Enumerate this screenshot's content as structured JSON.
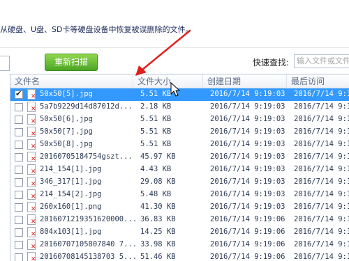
{
  "description": "从硬盘、U盘、SD卡等硬盘设备中恢复被误删除的文件。",
  "toolbar": {
    "scan_label": "重新扫描",
    "quick_find_label": "快速查找:",
    "quick_find_placeholder": "输入文件或文件"
  },
  "table": {
    "columns": [
      "文件名",
      "文件大小",
      "创建日期",
      "最后访问"
    ],
    "rows": [
      {
        "name": "50x50[5].jpg",
        "size": "5.51 KB",
        "created": "2016/7/14 9:19:03",
        "accessed": "2016/7/14 9:19",
        "checked": true,
        "selected": true
      },
      {
        "name": "5a7b9229d14d87012d...",
        "size": "2.18 KB",
        "created": "2016/7/14 9:19:03",
        "accessed": "2016/7/14 9:19",
        "checked": false,
        "selected": false
      },
      {
        "name": "50x50[6].jpg",
        "size": "5.51 KB",
        "created": "2016/7/14 9:19:03",
        "accessed": "2016/7/14 9:19",
        "checked": false,
        "selected": false
      },
      {
        "name": "50x50[7].jpg",
        "size": "5.51 KB",
        "created": "2016/7/14 9:19:03",
        "accessed": "2016/7/14 9:19",
        "checked": false,
        "selected": false
      },
      {
        "name": "50x50[8].jpg",
        "size": "5.51 KB",
        "created": "2016/7/14 9:19:03",
        "accessed": "2016/7/14 9:19",
        "checked": false,
        "selected": false
      },
      {
        "name": "20160705184754gszt...",
        "size": "45.97 KB",
        "created": "2016/7/14 9:19:03",
        "accessed": "2016/7/14 9:19",
        "checked": false,
        "selected": false
      },
      {
        "name": "214_154[1].jpg",
        "size": "4.43 KB",
        "created": "2016/7/14 9:19:03",
        "accessed": "2016/7/14 9:19",
        "checked": false,
        "selected": false
      },
      {
        "name": "346_317[1].jpg",
        "size": "29.08 KB",
        "created": "2016/7/14 9:19:03",
        "accessed": "2016/7/14 9:19",
        "checked": false,
        "selected": false
      },
      {
        "name": "214_154[2].jpg",
        "size": "5.48 KB",
        "created": "2016/7/14 9:19:03",
        "accessed": "2016/7/14 9:19",
        "checked": false,
        "selected": false
      },
      {
        "name": "260x160[1].png",
        "size": "41.30 KB",
        "created": "2016/7/14 9:19:03",
        "accessed": "2016/7/14 9:19",
        "checked": false,
        "selected": false
      },
      {
        "name": "2016071219351620000...",
        "size": "36.83 KB",
        "created": "2016/7/14 9:19:06",
        "accessed": "2016/7/14 9:19",
        "checked": false,
        "selected": false
      },
      {
        "name": "804x103[1].jpg",
        "size": "14.25 KB",
        "created": "2016/7/14 9:19:06",
        "accessed": "2016/7/14 9:19",
        "checked": false,
        "selected": false
      },
      {
        "name": "20160707105807840 7...",
        "size": "33.98 KB",
        "created": "2016/7/14 9:19:06",
        "accessed": "2016/7/14 9:19",
        "checked": false,
        "selected": false
      },
      {
        "name": "20160708145138703 5...",
        "size": "51.46 KB",
        "created": "2016/7/14 9:19:06",
        "accessed": "2016/7/14 9:19",
        "checked": false,
        "selected": false
      }
    ]
  },
  "colors": {
    "selected_row": "#3399ff",
    "scan_button": "#5cb82e",
    "annotation_arrow": "#e0201c"
  }
}
